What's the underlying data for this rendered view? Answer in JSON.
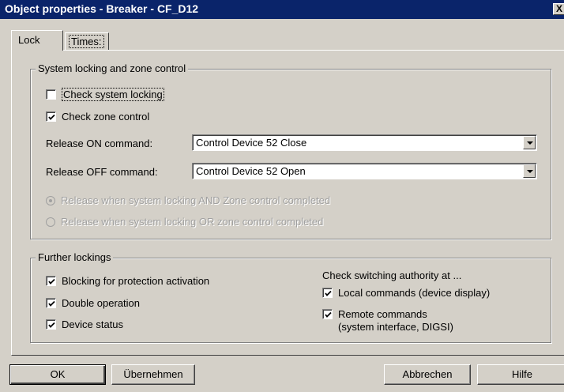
{
  "window": {
    "title": "Object properties - Breaker - CF_D12",
    "close_label": "X"
  },
  "tabs": [
    {
      "label": "Lock",
      "selected": true
    },
    {
      "label": "Times:",
      "selected": false
    }
  ],
  "system_group": {
    "title": "System locking and zone control",
    "check_system_locking": {
      "label": "Check system locking",
      "checked": false
    },
    "check_zone_control": {
      "label": "Check zone control",
      "checked": true
    },
    "release_on": {
      "label": "Release ON command:",
      "value": "Control Device   52 Close"
    },
    "release_off": {
      "label": "Release OFF command:",
      "value": "Control Device   52 Open"
    },
    "radio_and": {
      "label": "Release when system locking AND Zone control completed",
      "selected": true,
      "enabled": false
    },
    "radio_or": {
      "label": "Release when system locking OR zone control completed",
      "selected": false,
      "enabled": false
    }
  },
  "further_group": {
    "title": "Further lockings",
    "blocking": {
      "label": "Blocking for protection activation",
      "checked": true
    },
    "double_operation": {
      "label": "Double operation",
      "checked": true
    },
    "device_status": {
      "label": "Device status",
      "checked": true
    },
    "authority_title": "Check switching authority at ...",
    "local_commands": {
      "label": "Local commands (device display)",
      "checked": true
    },
    "remote_commands": {
      "label": "Remote commands",
      "sublabel": "(system interface, DIGSI)",
      "checked": true
    }
  },
  "buttons": {
    "ok": "OK",
    "apply": "Übernehmen",
    "cancel": "Abbrechen",
    "help": "Hilfe"
  },
  "icons": {
    "checkmark": "check-icon",
    "dropdown": "chevron-down-icon",
    "close": "close-icon"
  }
}
